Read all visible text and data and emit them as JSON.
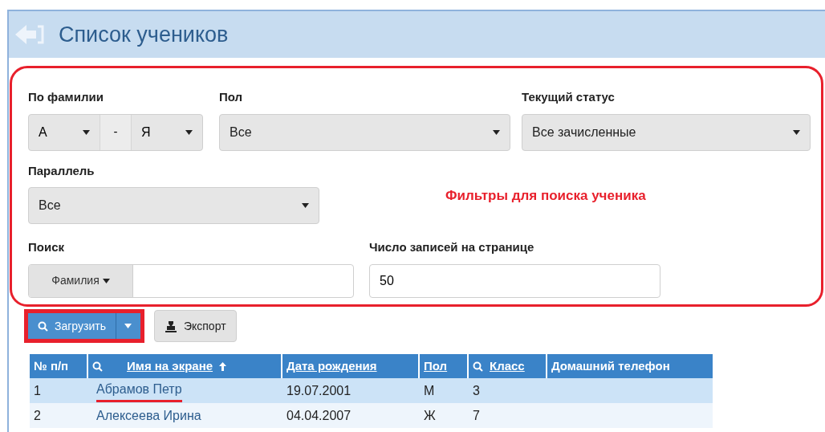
{
  "window": {
    "title": "Список учеников"
  },
  "filters": {
    "surname": {
      "label": "По фамилии",
      "from": "А",
      "separator": "-",
      "to": "Я"
    },
    "gender": {
      "label": "Пол",
      "value": "Все"
    },
    "status": {
      "label": "Текущий статус",
      "value": "Все зачисленные"
    },
    "grade": {
      "label": "Параллель",
      "value": "Все"
    },
    "search": {
      "label": "Поиск",
      "mode": "Фамилия"
    },
    "page_size": {
      "label": "Число записей на странице",
      "value": "50"
    }
  },
  "annotation": {
    "text": "Фильтры для поиска ученика"
  },
  "buttons": {
    "load": {
      "label": "Загрузить",
      "marked": true
    },
    "export": {
      "label": "Экспорт"
    }
  },
  "table": {
    "columns": [
      {
        "label": "№ п/п",
        "sortable": false,
        "searchable": false,
        "sorted_ascending": false
      },
      {
        "label": "Имя на экране",
        "sortable": true,
        "searchable": true,
        "sorted_ascending": true
      },
      {
        "label": "Дата рождения",
        "sortable": true,
        "searchable": false,
        "sorted_ascending": false
      },
      {
        "label": "Пол",
        "sortable": true,
        "searchable": false,
        "sorted_ascending": false
      },
      {
        "label": "Класс",
        "sortable": true,
        "searchable": true,
        "sorted_ascending": false
      },
      {
        "label": "Домашний телефон",
        "sortable": false,
        "searchable": false,
        "sorted_ascending": false
      }
    ],
    "rows": [
      {
        "number": "1",
        "name": "Абрамов Петр",
        "name_marked": true,
        "birth_date": "19.07.2001",
        "gender": "М",
        "class": "3"
      },
      {
        "number": "2",
        "name": "Алексеева Ирина",
        "name_marked": false,
        "birth_date": "04.04.2007",
        "gender": "Ж",
        "class": "7"
      }
    ]
  }
}
